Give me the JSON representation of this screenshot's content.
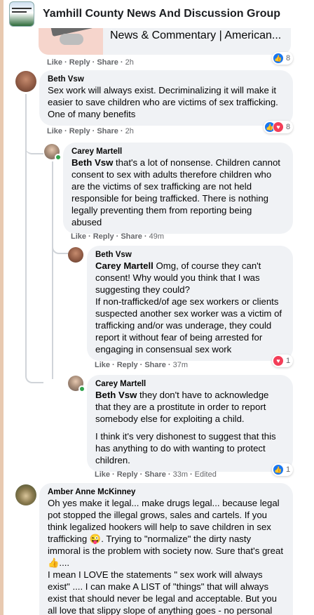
{
  "header": {
    "group_title": "Yamhill County News And Discussion Group"
  },
  "link_preview": {
    "title": "News & Commentary | American..."
  },
  "first_comment_actions": {
    "like": "Like",
    "reply": "Reply",
    "share": "Share",
    "time": "2h",
    "reaction_count": "8"
  },
  "comments": [
    {
      "author": "Beth Vsw",
      "text": "Sex work will always exist. Decriminalizing it will make it easier to save children who are victims of sex trafficking. One of many benefits",
      "like": "Like",
      "reply": "Reply",
      "share": "Share",
      "time": "2h",
      "reaction_count": "8"
    },
    {
      "author": "Carey Martell",
      "mention": "Beth Vsw",
      "text": " that's a lot of nonsense. Children cannot consent to sex with adults therefore children who are the victims of sex trafficking are not held responsible for being trafficked. There is nothing legally preventing them from reporting being abused",
      "like": "Like",
      "reply": "Reply",
      "share": "Share",
      "time": "49m"
    },
    {
      "author": "Beth Vsw",
      "mention": "Carey Martell",
      "text1": " Omg, of course they can't consent! Why would you think that I was suggesting they could?",
      "text2": "If non-trafficked/of age sex workers or clients suspected another sex worker was a victim of trafficking and/or was underage, they could report it without fear of being arrested for engaging in consensual sex work",
      "like": "Like",
      "reply": "Reply",
      "share": "Share",
      "time": "37m",
      "reaction_count": "1"
    },
    {
      "author": "Carey Martell",
      "mention": "Beth Vsw",
      "text1": " they don't have to acknowledge that they are a prostitute in order to report somebody else for exploiting a child.",
      "text2": "I think it's very dishonest to suggest that this has anything to do with wanting to protect children.",
      "like": "Like",
      "reply": "Reply",
      "share": "Share",
      "time": "33m",
      "edited": "Edited",
      "reaction_count": "1"
    },
    {
      "author": "Amber Anne McKinney",
      "text1": "Oh yes make it legal... make drugs legal... because legal pot stopped the illegal grows, sales and cartels. If you think legalized hookers will help to save children in sex trafficking 😜. Trying to \"normalize\" the dirty nasty immoral is the problem with society now. Sure that's great 👍....",
      "text2": "I mean I LOVE the statements \" sex work will always exist\" .... I can make A LIST of \"things\" that will always exist that should never be legal and acceptable. But you all love that slippy slope of anything goes - no personal"
    }
  ],
  "colors": {
    "bubble": "#f0f2f5",
    "meta_text": "#65676b",
    "like_blue": "#1877f2",
    "love_red": "#f33e58",
    "online_green": "#31a24c"
  },
  "icons": {
    "like": "thumbs-up-icon",
    "love": "heart-icon"
  }
}
